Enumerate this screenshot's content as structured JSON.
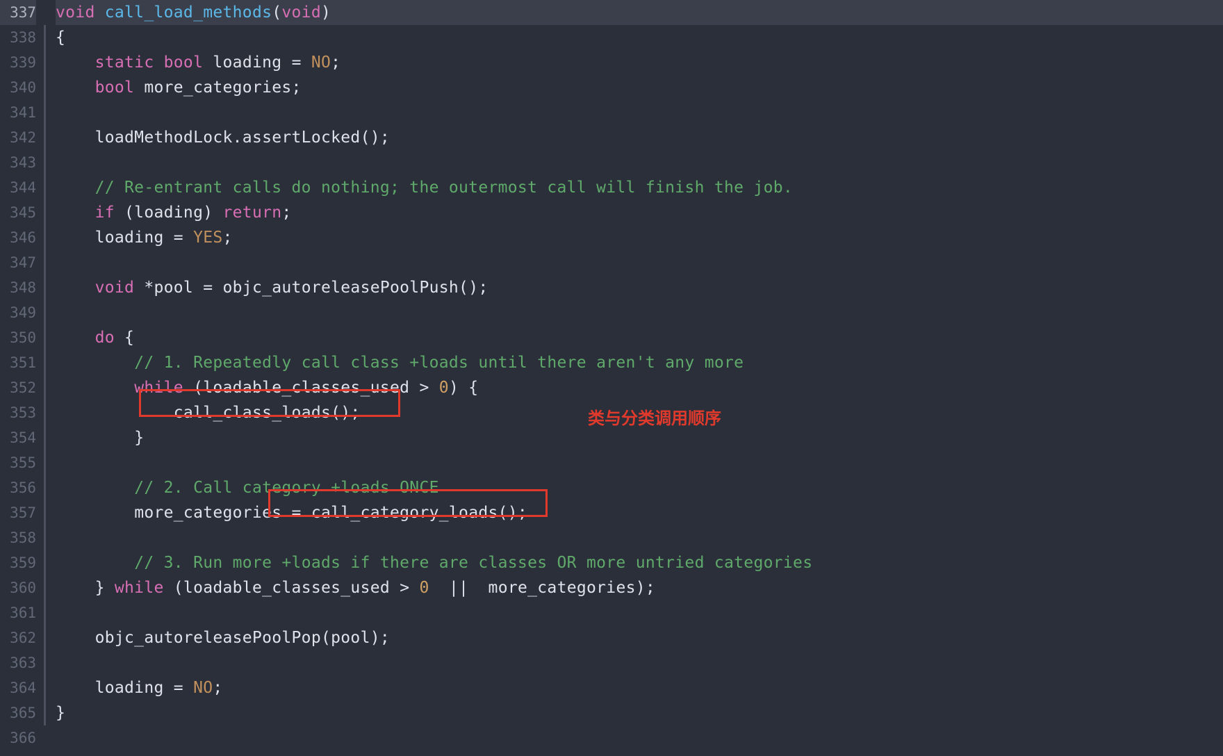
{
  "gutter": {
    "start": 337,
    "end": 366,
    "highlighted": 337
  },
  "annotation": "类与分类调用顺序",
  "code": {
    "l337_kw1": "void",
    "l337_fn": " call_load_methods",
    "l337_p": "(",
    "l337_kw2": "void",
    "l337_p2": ")",
    "l338": "{",
    "l339_ind": "    ",
    "l339_kw1": "static",
    "l339_sp1": " ",
    "l339_kw2": "bool",
    "l339_txt": " loading ",
    "l339_op": "=",
    "l339_sp2": " ",
    "l339_con": "NO",
    "l339_sc": ";",
    "l340_ind": "    ",
    "l340_kw": "bool",
    "l340_txt": " more_categories;",
    "l341": "",
    "l342_ind": "    ",
    "l342_txt": "loadMethodLock.assertLocked();",
    "l343": "",
    "l344_ind": "    ",
    "l344_cmt": "// Re-entrant calls do nothing; the outermost call will finish the job.",
    "l345_ind": "    ",
    "l345_kw1": "if",
    "l345_txt": " (loading) ",
    "l345_kw2": "return",
    "l345_sc": ";",
    "l346_ind": "    ",
    "l346_txt": "loading ",
    "l346_op": "=",
    "l346_sp": " ",
    "l346_con": "YES",
    "l346_sc": ";",
    "l347": "",
    "l348_ind": "    ",
    "l348_kw": "void",
    "l348_txt": " *pool = objc_autoreleasePoolPush();",
    "l349": "",
    "l350_ind": "    ",
    "l350_kw": "do",
    "l350_txt": " {",
    "l351_ind": "        ",
    "l351_cmt": "// 1. Repeatedly call class +loads until there aren't any more",
    "l352_ind": "        ",
    "l352_kw": "while",
    "l352_txt1": " (loadable_classes_used ",
    "l352_op": ">",
    "l352_sp": " ",
    "l352_num": "0",
    "l352_txt2": ") {",
    "l353_ind": "            ",
    "l353_txt": "call_class_loads();",
    "l354_ind": "        ",
    "l354_txt": "}",
    "l355": "",
    "l356_ind": "        ",
    "l356_cmt": "// 2. Call category +loads ONCE",
    "l357_ind": "        ",
    "l357_txt": "more_categories = call_category_loads();",
    "l358": "",
    "l359_ind": "        ",
    "l359_cmt": "// 3. Run more +loads if there are classes OR more untried categories",
    "l360_ind": "    ",
    "l360_txt1": "} ",
    "l360_kw": "while",
    "l360_txt2": " (loadable_classes_used ",
    "l360_op1": ">",
    "l360_sp1": " ",
    "l360_num": "0",
    "l360_txt3": "  ",
    "l360_op2": "||",
    "l360_txt4": "  more_categories);",
    "l361": "",
    "l362_ind": "    ",
    "l362_txt": "objc_autoreleasePoolPop(pool);",
    "l363": "",
    "l364_ind": "    ",
    "l364_txt": "loading ",
    "l364_op": "=",
    "l364_sp": " ",
    "l364_con": "NO",
    "l364_sc": ";",
    "l365": "}",
    "l366": ""
  }
}
